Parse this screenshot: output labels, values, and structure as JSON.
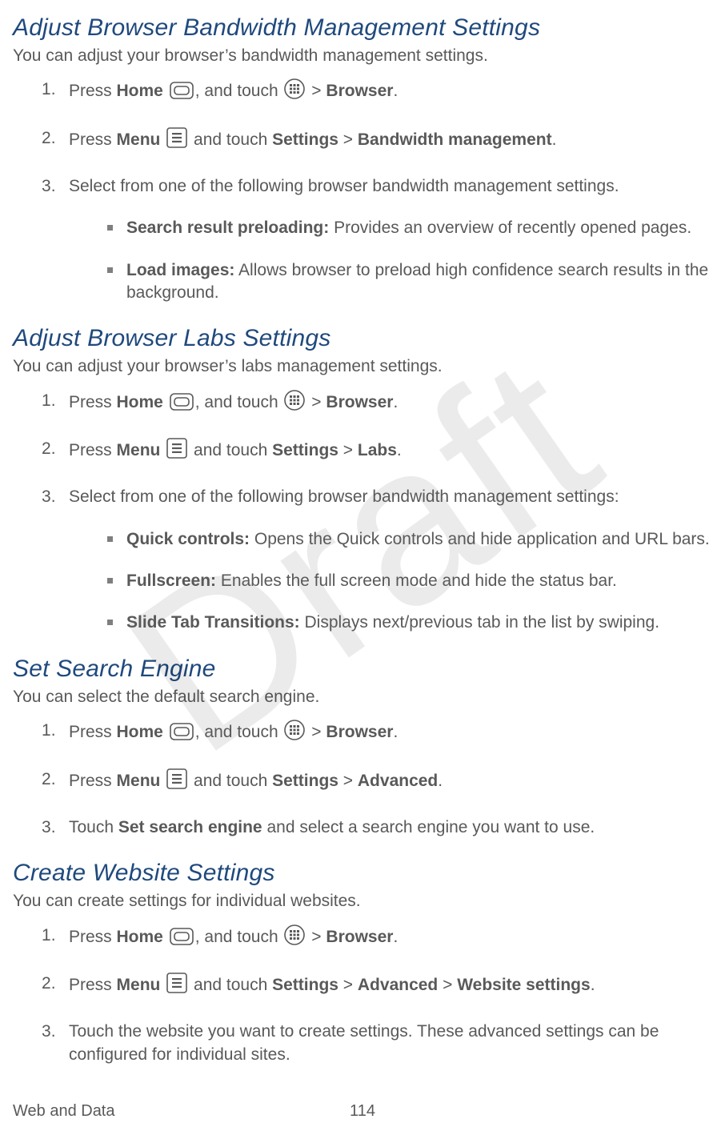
{
  "watermark": "Draft",
  "footer": {
    "section": "Web and Data",
    "page": "114"
  },
  "common": {
    "press": "Press ",
    "touch": "Touch ",
    "select": "Select from one of the following browser bandwidth management settings",
    "home": "Home",
    "menu": "Menu",
    "and_touch_sp": ", and touch ",
    "and_touch": " and touch ",
    "gt": " > ",
    "browser": "Browser",
    "settings": "Settings",
    "period": ".",
    "colon": ":"
  },
  "sections": {
    "bandwidth": {
      "heading": "Adjust Browser Bandwidth Management Settings",
      "intro": "You can adjust your browser’s bandwidth management settings.",
      "step2_target": "Bandwidth management",
      "bullets": [
        {
          "term": "Search result preloading:",
          "desc": " Provides an overview of recently opened pages."
        },
        {
          "term": "Load images:",
          "desc": " Allows browser to preload high confidence search results in the background."
        }
      ]
    },
    "labs": {
      "heading": "Adjust Browser Labs Settings",
      "intro": "You can adjust your browser’s labs management settings.",
      "step2_target": "Labs",
      "bullets": [
        {
          "term": "Quick controls:",
          "desc": " Opens the Quick controls and hide application and URL bars."
        },
        {
          "term": "Fullscreen:",
          "desc": " Enables the full screen mode and hide the status bar."
        },
        {
          "term": "Slide Tab Transitions:",
          "desc": " Displays next/previous tab in the list by swiping."
        }
      ]
    },
    "search": {
      "heading": "Set Search Engine",
      "intro": "You can select the default search engine.",
      "step2_target": "Advanced",
      "step3_a": "Set search engine",
      "step3_b": " and select a search engine you want to use."
    },
    "website": {
      "heading": "Create Website Settings",
      "intro": "You can create settings for individual websites.",
      "step2_mid": "Advanced",
      "step2_target": "Website settings",
      "step3": "Touch the website you want to create settings. These advanced settings can be configured for individual sites."
    }
  }
}
